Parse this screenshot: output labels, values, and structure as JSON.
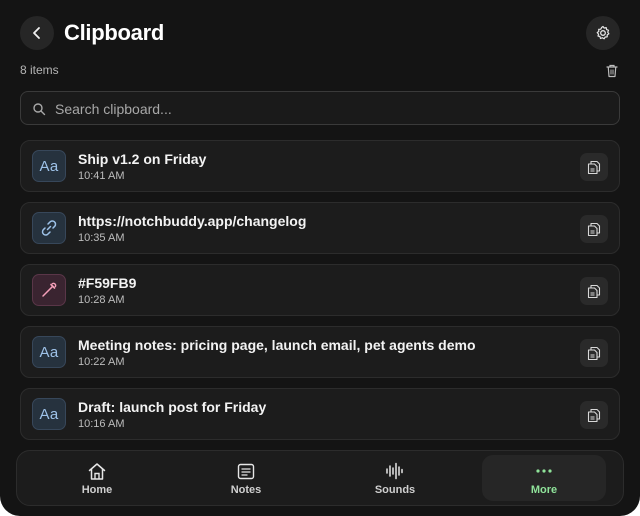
{
  "header": {
    "title": "Clipboard"
  },
  "summary": {
    "count_text": "8 items"
  },
  "search": {
    "placeholder": "Search clipboard..."
  },
  "items": [
    {
      "kind": "text",
      "thumb": "Aa",
      "label": "Ship v1.2 on Friday",
      "time": "10:41 AM"
    },
    {
      "kind": "link",
      "thumb": "link-icon",
      "label": "https://notchbuddy.app/changelog",
      "time": "10:35 AM"
    },
    {
      "kind": "color",
      "thumb": "eyedropper-icon",
      "label": "#F59FB9",
      "time": "10:28 AM",
      "color": "#F59FB9"
    },
    {
      "kind": "text",
      "thumb": "Aa",
      "label": "Meeting notes: pricing page, launch email, pet agents demo",
      "time": "10:22 AM"
    },
    {
      "kind": "text",
      "thumb": "Aa",
      "label": "Draft: launch post for Friday",
      "time": "10:16 AM"
    }
  ],
  "tabs": [
    {
      "label": "Home",
      "icon": "home-icon"
    },
    {
      "label": "Notes",
      "icon": "notes-icon"
    },
    {
      "label": "Sounds",
      "icon": "waveform-icon"
    },
    {
      "label": "More",
      "icon": "more-icon",
      "active": true
    }
  ],
  "colors": {
    "background": "#141414",
    "card": "#1c1c1c",
    "accent_green": "#8fe39a",
    "thumb_blue": "#9ec2e8"
  }
}
